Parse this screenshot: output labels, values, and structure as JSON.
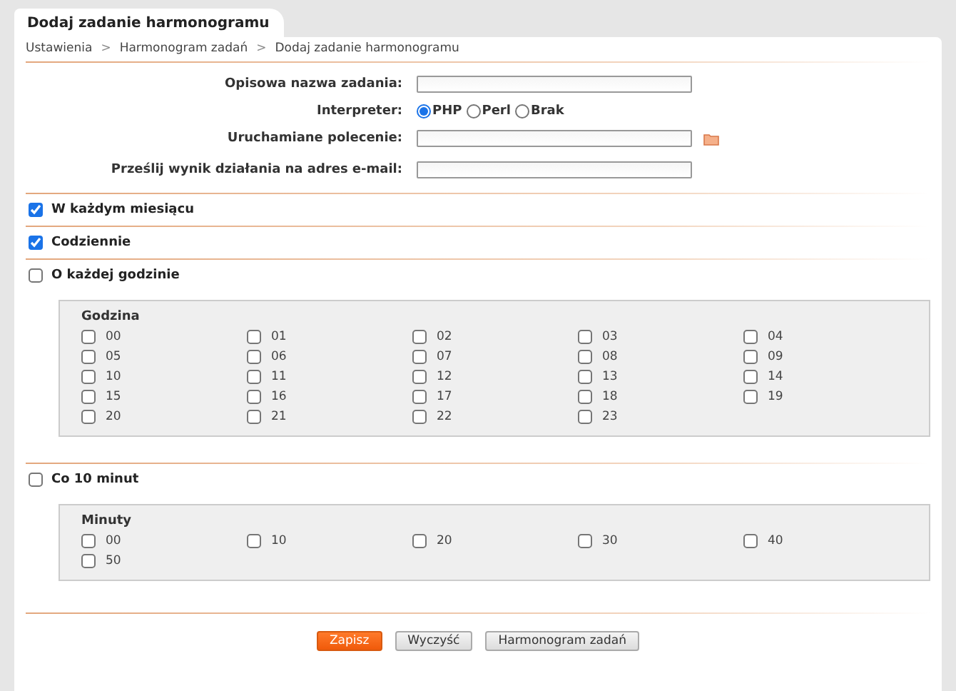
{
  "tab": {
    "title": "Dodaj zadanie harmonogramu"
  },
  "breadcrumb": {
    "separator": ">",
    "items": [
      "Ustawienia",
      "Harmonogram zadań",
      "Dodaj zadanie harmonogramu"
    ]
  },
  "fields": [
    {
      "kind": "text",
      "label": "Opisowa nazwa zadania:",
      "browse": false
    },
    {
      "kind": "radio",
      "label": "Interpreter:",
      "options": [
        {
          "label": "PHP",
          "selected": true
        },
        {
          "label": "Perl",
          "selected": false
        },
        {
          "label": "Brak",
          "selected": false
        }
      ]
    },
    {
      "kind": "text",
      "label": "Uruchamiane polecenie:",
      "browse": true
    },
    {
      "kind": "text",
      "label": "Prześlij wynik działania na adres e-mail:",
      "browse": false
    }
  ],
  "sections": [
    {
      "label": "W każdym miesiącu",
      "checked": true
    },
    {
      "label": "Codziennie",
      "checked": true
    },
    {
      "label": "O każdej godzinie",
      "checked": false,
      "group": {
        "title": "Godzina",
        "options": [
          {
            "label": "00",
            "checked": false
          },
          {
            "label": "01",
            "checked": false
          },
          {
            "label": "02",
            "checked": false
          },
          {
            "label": "03",
            "checked": false
          },
          {
            "label": "04",
            "checked": false
          },
          {
            "label": "05",
            "checked": false
          },
          {
            "label": "06",
            "checked": false
          },
          {
            "label": "07",
            "checked": false
          },
          {
            "label": "08",
            "checked": false
          },
          {
            "label": "09",
            "checked": false
          },
          {
            "label": "10",
            "checked": false
          },
          {
            "label": "11",
            "checked": false
          },
          {
            "label": "12",
            "checked": false
          },
          {
            "label": "13",
            "checked": false
          },
          {
            "label": "14",
            "checked": false
          },
          {
            "label": "15",
            "checked": false
          },
          {
            "label": "16",
            "checked": false
          },
          {
            "label": "17",
            "checked": false
          },
          {
            "label": "18",
            "checked": false
          },
          {
            "label": "19",
            "checked": false
          },
          {
            "label": "20",
            "checked": false
          },
          {
            "label": "21",
            "checked": false
          },
          {
            "label": "22",
            "checked": false
          },
          {
            "label": "23",
            "checked": false
          }
        ]
      }
    },
    {
      "label": "Co 10 minut",
      "checked": false,
      "group": {
        "title": "Minuty",
        "options": [
          {
            "label": "00",
            "checked": false
          },
          {
            "label": "10",
            "checked": false
          },
          {
            "label": "20",
            "checked": false
          },
          {
            "label": "30",
            "checked": false
          },
          {
            "label": "40",
            "checked": false
          },
          {
            "label": "50",
            "checked": false
          }
        ]
      }
    }
  ],
  "buttons": [
    {
      "label": "Zapisz",
      "kind": "primary"
    },
    {
      "label": "Wyczyść",
      "kind": "secondary"
    },
    {
      "label": "Harmonogram zadań",
      "kind": "secondary"
    }
  ]
}
